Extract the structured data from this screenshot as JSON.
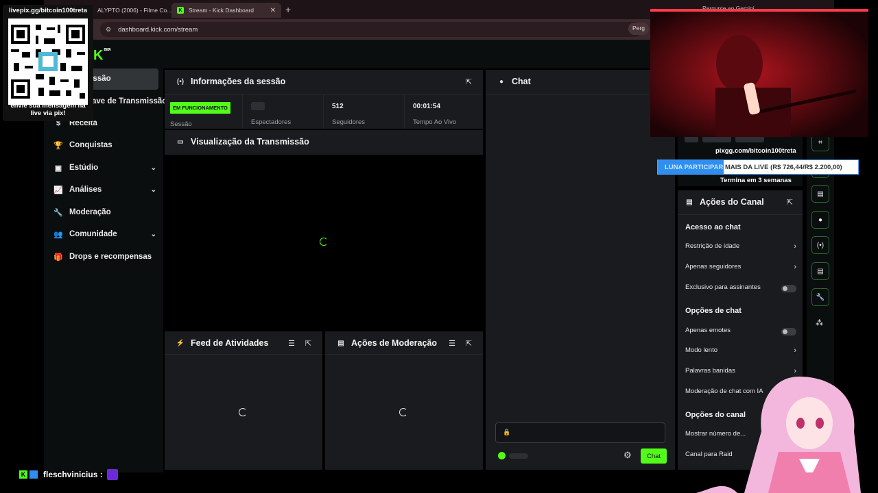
{
  "browser": {
    "tabs": [
      {
        "label": "ALYPTO (2006) - Filme Co..."
      },
      {
        "label": "Stream - Kick Dashboard"
      }
    ],
    "new_tab": "+",
    "url": "dashboard.kick.com/stream",
    "gemini_label": "Pergunte ao Gemini",
    "perg_label": "Perg"
  },
  "logo": {
    "text": "K",
    "beta": "BETA"
  },
  "sidebar": {
    "items": [
      {
        "label": "missão"
      },
      {
        "label": "ave de Transmissão"
      },
      {
        "label": "Receita"
      },
      {
        "label": "Conquistas"
      },
      {
        "label": "Estúdio"
      },
      {
        "label": "Análises"
      },
      {
        "label": "Moderação"
      },
      {
        "label": "Comunidade"
      },
      {
        "label": "Drops e recompensas"
      }
    ]
  },
  "session": {
    "title": "Informações da sessão",
    "status_badge": "EM FUNCIONAMENTO",
    "stats": [
      {
        "label": "Sessão"
      },
      {
        "label": "Espectadores"
      },
      {
        "value": "512",
        "label": "Seguidores"
      },
      {
        "value": "00:01:54",
        "label": "Tempo Ao Vivo"
      }
    ]
  },
  "preview": {
    "title": "Visualização da Transmissão"
  },
  "feed": {
    "title": "Feed de Atividades"
  },
  "modactions": {
    "title": "Ações de Moderação"
  },
  "chat": {
    "title": "Chat",
    "send_label": "Chat"
  },
  "channel_actions": {
    "title": "Ações do Canal",
    "sections": [
      {
        "heading": "Acesso ao chat",
        "items": [
          "Restrição de idade",
          "Apenas seguidores",
          "Exclusivo para assinantes"
        ]
      },
      {
        "heading": "Opções de chat",
        "items": [
          "Apenas emotes",
          "Modo lento",
          "Palavras banidas",
          "Moderação de chat com IA"
        ]
      },
      {
        "heading": "Opções do canal",
        "items": [
          "Mostrar número de...",
          "Canal para Raid"
        ]
      }
    ]
  },
  "overlay": {
    "qr_url": "livepix.gg/bitcoin100treta",
    "qr_message_1": "envie sua mensagem na",
    "qr_message_2": "live via pix!",
    "pix_url": "pixgg.com/bitcoin100treta",
    "goal_label_highlight": "LUNA PARTICIPAR",
    "goal_label_rest": " MAIS DA LIVE (R$ 726,44/R$ 2.200,00)",
    "goal_progress": 0.33,
    "goal_ends": "Termina em 3 semanas",
    "chat_user": "fleschvinicius :"
  },
  "colors": {
    "accent": "#53fc18",
    "panel": "#191b1f",
    "goal_blue": "#2f8ff0"
  }
}
